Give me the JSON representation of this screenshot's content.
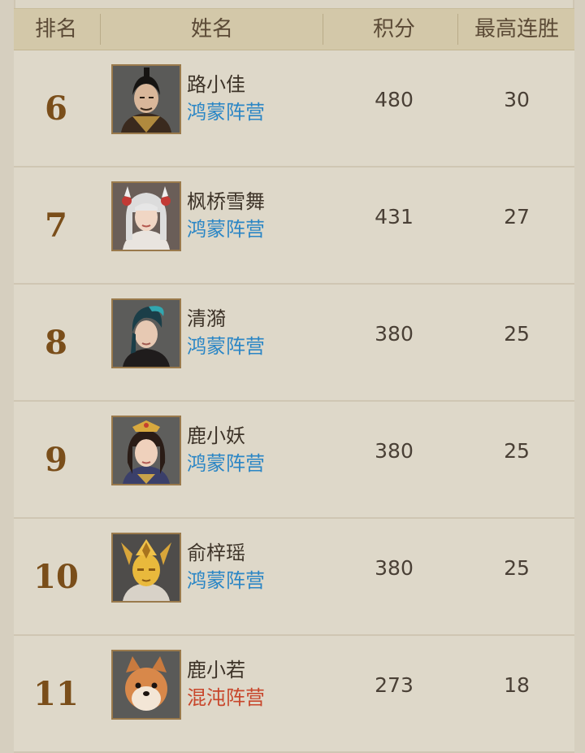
{
  "header": {
    "rank": "排名",
    "name": "姓名",
    "score": "积分",
    "streak": "最高连胜"
  },
  "colors": {
    "camp_hongmeng": "#2b86c5",
    "camp_hundun": "#c8462b",
    "rank": "#7a4e1a"
  },
  "rows": [
    {
      "rank": "6",
      "name": "路小佳",
      "camp": "鸿蒙阵营",
      "score": "480",
      "streak": "30",
      "avatar_icon": "swordsman-avatar-icon"
    },
    {
      "rank": "7",
      "name": "枫桥雪舞",
      "camp": "鸿蒙阵营",
      "score": "431",
      "streak": "27",
      "avatar_icon": "white-hair-girl-avatar-icon"
    },
    {
      "rank": "8",
      "name": "清漪",
      "camp": "鸿蒙阵营",
      "score": "380",
      "streak": "25",
      "avatar_icon": "teal-hair-avatar-icon"
    },
    {
      "rank": "9",
      "name": "鹿小妖",
      "camp": "鸿蒙阵营",
      "score": "380",
      "streak": "25",
      "avatar_icon": "princess-avatar-icon"
    },
    {
      "rank": "10",
      "name": "俞梓瑶",
      "camp": "鸿蒙阵营",
      "score": "380",
      "streak": "25",
      "avatar_icon": "golden-mask-avatar-icon"
    },
    {
      "rank": "11",
      "name": "鹿小若",
      "camp": "混沌阵营",
      "score": "273",
      "streak": "18",
      "avatar_icon": "shiba-dog-avatar-icon"
    }
  ]
}
